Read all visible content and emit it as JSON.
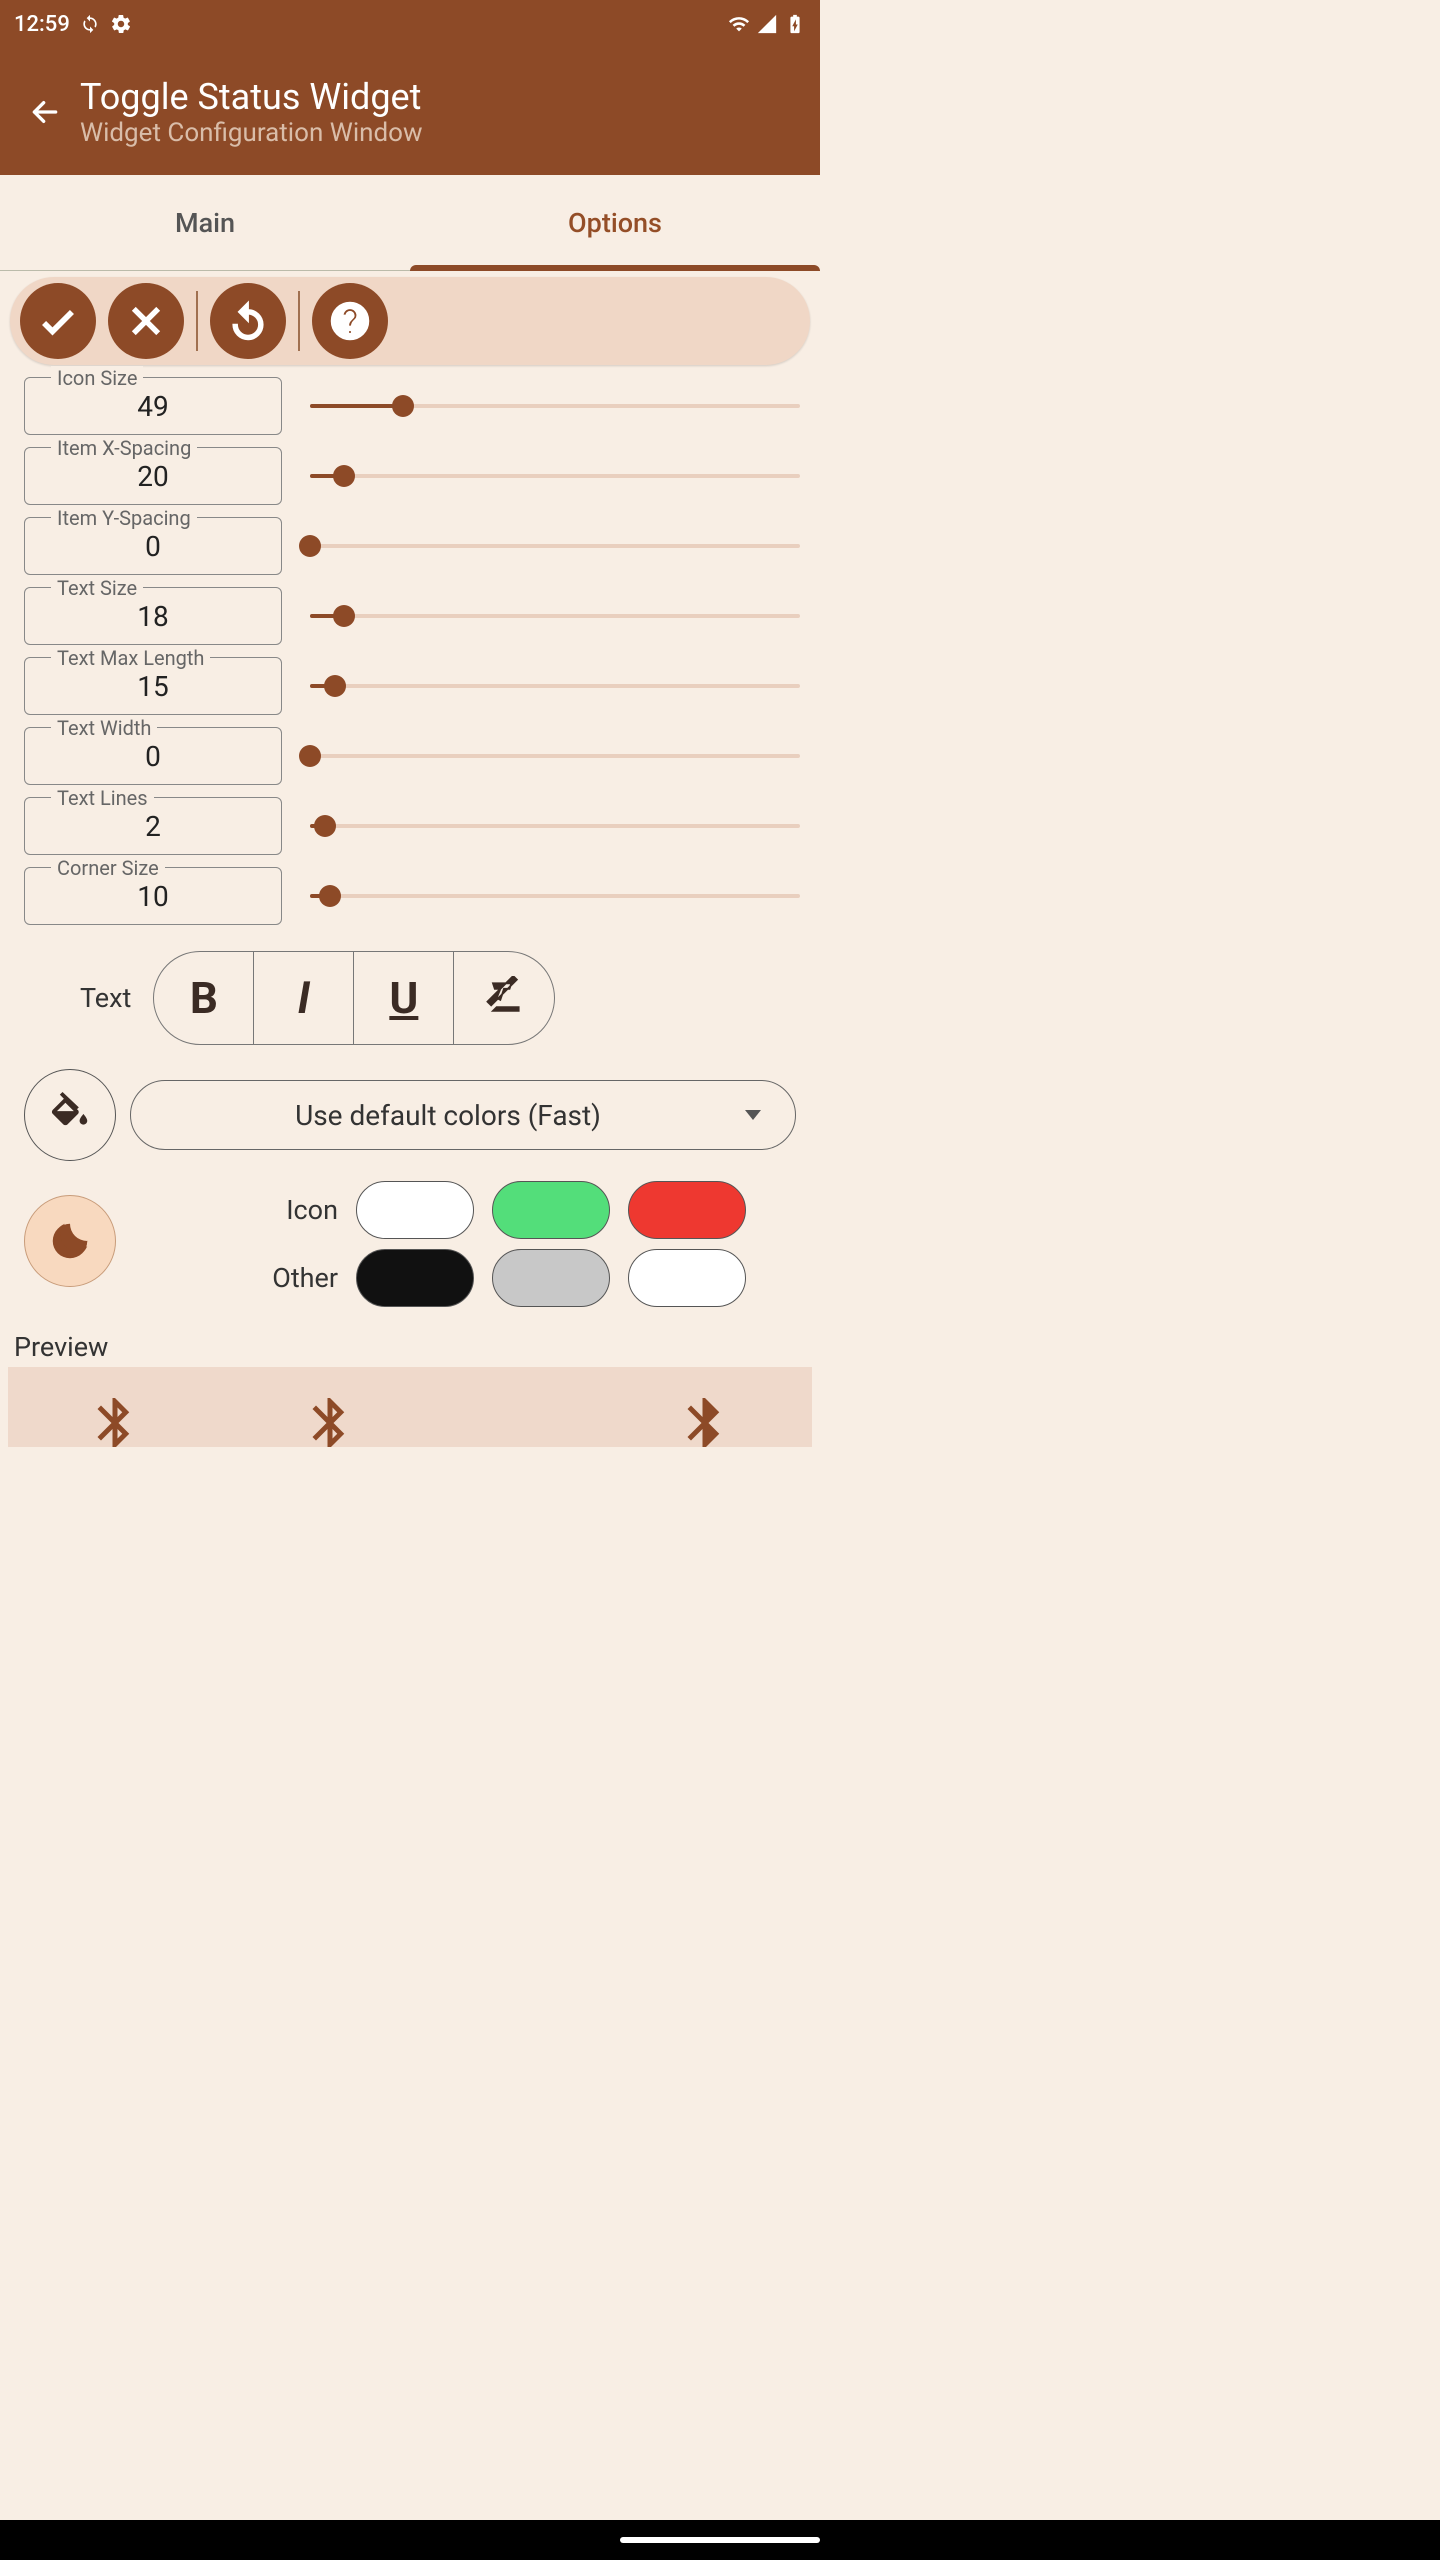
{
  "statusbar": {
    "time": "12:59"
  },
  "appbar": {
    "title": "Toggle Status Widget",
    "subtitle": "Widget Configuration Window"
  },
  "tabs": {
    "main": "Main",
    "options": "Options"
  },
  "fields": [
    {
      "label": "Icon Size",
      "value": "49",
      "pct": 19
    },
    {
      "label": "Item X-Spacing",
      "value": "20",
      "pct": 7
    },
    {
      "label": "Item Y-Spacing",
      "value": "0",
      "pct": 0
    },
    {
      "label": "Text Size",
      "value": "18",
      "pct": 7
    },
    {
      "label": "Text Max Length",
      "value": "15",
      "pct": 5
    },
    {
      "label": "Text Width",
      "value": "0",
      "pct": 0
    },
    {
      "label": "Text Lines",
      "value": "2",
      "pct": 3
    },
    {
      "label": "Corner Size",
      "value": "10",
      "pct": 4
    }
  ],
  "text_label": "Text",
  "color_select": "Use default colors (Fast)",
  "labels": {
    "icon": "Icon",
    "other": "Other",
    "preview": "Preview"
  },
  "swatches": {
    "icon": [
      "#ffffff",
      "#53de7a",
      "#ee3830"
    ],
    "other": [
      "#111111",
      "#c8c8c8",
      "#ffffff"
    ]
  }
}
